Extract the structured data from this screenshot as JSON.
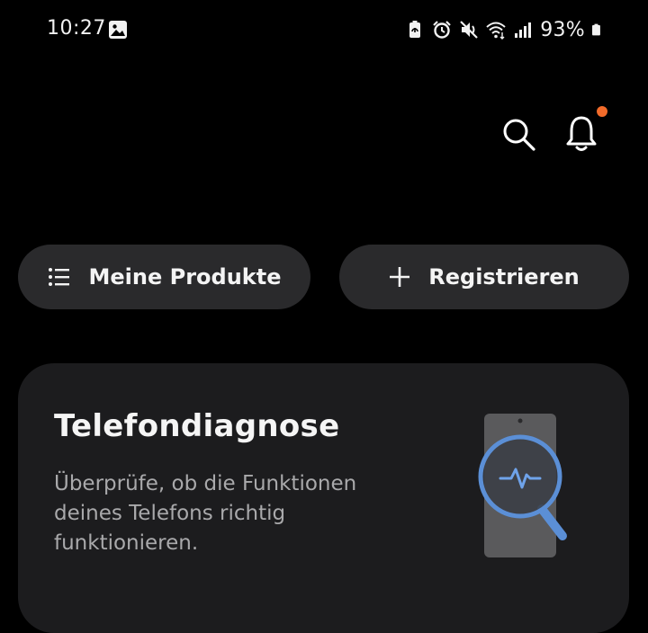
{
  "status_bar": {
    "time": "10:27",
    "icons": [
      "gallery-icon",
      "battery-saver-icon",
      "alarm-icon",
      "mute-icon",
      "wifi-icon",
      "signal-icon",
      "battery-icon"
    ],
    "battery_percent": "93%"
  },
  "header": {
    "search_icon": "search-icon",
    "notification_icon": "bell-icon",
    "notification_dot_color": "#f26b2a"
  },
  "actions": {
    "my_products_label": "Meine Produkte",
    "register_label": "Registrieren"
  },
  "diagnosis_card": {
    "title": "Telefondiagnose",
    "description": "Überprüfe, ob die Funktionen deines Telefons richtig funktionieren.",
    "accent_color": "#5b8fd6"
  }
}
